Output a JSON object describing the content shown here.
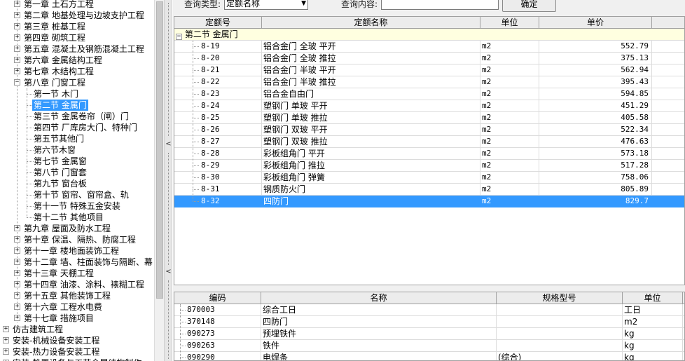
{
  "tree": {
    "chapters_top": [
      {
        "label": "第一章  土石方工程"
      },
      {
        "label": "第二章  地基处理与边坡支护工程"
      },
      {
        "label": "第三章  桩基工程"
      },
      {
        "label": "第四章  砌筑工程"
      },
      {
        "label": "第五章  混凝土及钢筋混凝土工程"
      },
      {
        "label": "第六章  金属结构工程"
      },
      {
        "label": "第七章  木结构工程"
      }
    ],
    "chapter_open": {
      "label": "第八章  门窗工程"
    },
    "sections": [
      {
        "label": "第一节  木门"
      },
      {
        "label": "第二节  金属门"
      },
      {
        "label": "第三节  金属卷帘（闸）门"
      },
      {
        "label": "第四节  厂库房大门、特种门"
      },
      {
        "label": "第五节其他门"
      },
      {
        "label": "第六节木窗"
      },
      {
        "label": "第七节  金属窗"
      },
      {
        "label": "第八节  门窗套"
      },
      {
        "label": "第九节  窗台板"
      },
      {
        "label": "第十节  窗帘、窗帘盒、轨"
      },
      {
        "label": "第十一节  特殊五金安装"
      },
      {
        "label": "第十二节  其他项目"
      }
    ],
    "selected_section": "第二节  金属门",
    "chapters_bottom": [
      {
        "label": "第九章  屋面及防水工程"
      },
      {
        "label": "第十章  保温、隔热、防腐工程"
      },
      {
        "label": "第十一章  楼地面装饰工程"
      },
      {
        "label": "第十二章  墙、柱面装饰与隔断、幕"
      },
      {
        "label": "第十三章  天棚工程"
      },
      {
        "label": "第十四章  油漆、涂料、裱糊工程"
      },
      {
        "label": "第十五章  其他装饰工程"
      },
      {
        "label": "第十六章  工程水电费"
      },
      {
        "label": "第十七章  措施项目"
      }
    ],
    "roots": [
      {
        "label": "仿古建筑工程"
      },
      {
        "label": "安装-机械设备安装工程"
      },
      {
        "label": "安装-热力设备安装工程"
      },
      {
        "label": "安装-静置设备与工艺金属结构制作"
      }
    ]
  },
  "splitter": {
    "collapse_glyph": "<",
    "expand_glyph": "<"
  },
  "query": {
    "type_label": "查询类型:",
    "type_value": "定额名称",
    "content_label": "查询内容:",
    "content_value": "",
    "confirm_label": "确定"
  },
  "quota_table": {
    "headers": [
      "定额号",
      "定额名称",
      "单位",
      "单价"
    ],
    "group_toggle": "−",
    "group": "第二节  金属门",
    "rows": [
      {
        "code": "8-19",
        "name": "铝合金门  全玻  平开",
        "unit": "m2",
        "price": "552.79"
      },
      {
        "code": "8-20",
        "name": "铝合金门  全玻  推拉",
        "unit": "m2",
        "price": "375.13"
      },
      {
        "code": "8-21",
        "name": "铝合金门  半玻  平开",
        "unit": "m2",
        "price": "562.94"
      },
      {
        "code": "8-22",
        "name": "铝合金门  半玻  推拉",
        "unit": "m2",
        "price": "395.43"
      },
      {
        "code": "8-23",
        "name": "铝合金自由门",
        "unit": "m2",
        "price": "594.85"
      },
      {
        "code": "8-24",
        "name": "塑钢门  单玻  平开",
        "unit": "m2",
        "price": "451.29"
      },
      {
        "code": "8-25",
        "name": "塑钢门  单玻  推拉",
        "unit": "m2",
        "price": "405.58"
      },
      {
        "code": "8-26",
        "name": "塑钢门  双玻  平开",
        "unit": "m2",
        "price": "522.34"
      },
      {
        "code": "8-27",
        "name": "塑钢门  双玻  推拉",
        "unit": "m2",
        "price": "476.63"
      },
      {
        "code": "8-28",
        "name": "彩板组角门  平开",
        "unit": "m2",
        "price": "573.18"
      },
      {
        "code": "8-29",
        "name": "彩板组角门  推拉",
        "unit": "m2",
        "price": "517.28"
      },
      {
        "code": "8-30",
        "name": "彩板组角门  弹簧",
        "unit": "m2",
        "price": "758.06"
      },
      {
        "code": "8-31",
        "name": "钢质防火门",
        "unit": "m2",
        "price": "805.89"
      },
      {
        "code": "8-32",
        "name": "四防门",
        "unit": "m2",
        "price": "829.7"
      }
    ],
    "selected_code": "8-32"
  },
  "resource_table": {
    "headers": [
      "编码",
      "名称",
      "规格型号",
      "单位"
    ],
    "rows": [
      {
        "code": "870003",
        "name": "综合工日",
        "spec": "",
        "unit": "工日"
      },
      {
        "code": "370148",
        "name": "四防门",
        "spec": "",
        "unit": "m2"
      },
      {
        "code": "090273",
        "name": "预埋铁件",
        "spec": "",
        "unit": "kg"
      },
      {
        "code": "090263",
        "name": "铁件",
        "spec": "",
        "unit": "kg"
      },
      {
        "code": "090290",
        "name": "电焊条",
        "spec": "(综合)",
        "unit": "kg"
      }
    ]
  },
  "colors": {
    "selection": "#3399ff",
    "group_row": "#ffffe0",
    "header": "#ececec"
  }
}
